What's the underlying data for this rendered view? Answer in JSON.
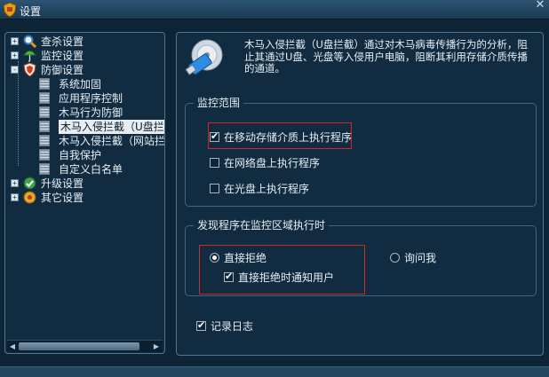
{
  "window": {
    "title": "设置",
    "close_label": "✕"
  },
  "tree": {
    "categories": [
      {
        "label": "查杀设置",
        "expander": "+",
        "icon": "scan-shield-icon"
      },
      {
        "label": "监控设置",
        "expander": "+",
        "icon": "umbrella-icon"
      },
      {
        "label": "防御设置",
        "expander": "-",
        "icon": "defense-shield-icon"
      },
      {
        "label": "升级设置",
        "expander": "+",
        "icon": "upgrade-globe-icon"
      },
      {
        "label": "其它设置",
        "expander": "+",
        "icon": "other-settings-icon"
      }
    ],
    "defense_children": [
      "系统加固",
      "应用程序控制",
      "木马行为防御",
      "木马入侵拦截（U盘拦截",
      "木马入侵拦截（网站拦",
      "自我保护",
      "自定义白名单"
    ],
    "selected_child": "木马入侵拦截（U盘拦截"
  },
  "main": {
    "description": "木马入侵拦截（U盘拦截）通过对木马病毒传播行为的分析，阻止其通过U盘、光盘等入侵用户电脑，阻断其利用存储介质传播的通道。",
    "monitor_scope": {
      "title": "监控范围",
      "options": [
        {
          "label": "在移动存储介质上执行程序",
          "checked": true
        },
        {
          "label": "在网络盘上执行程序",
          "checked": false
        },
        {
          "label": "在光盘上执行程序",
          "checked": false
        }
      ]
    },
    "on_detect": {
      "title": "发现程序在监控区域执行时",
      "radio_reject": {
        "label": "直接拒绝",
        "selected": true
      },
      "radio_ask": {
        "label": "询问我",
        "selected": false
      },
      "notify": {
        "label": "直接拒绝时通知用户",
        "checked": true
      }
    },
    "log": {
      "label": "记录日志",
      "checked": true
    }
  },
  "colors": {
    "background": "#0d2536",
    "panel": "#112c40",
    "panel_border": "#4e7692",
    "highlight_box": "#d32626",
    "selection_bg": "#e8edf2"
  }
}
